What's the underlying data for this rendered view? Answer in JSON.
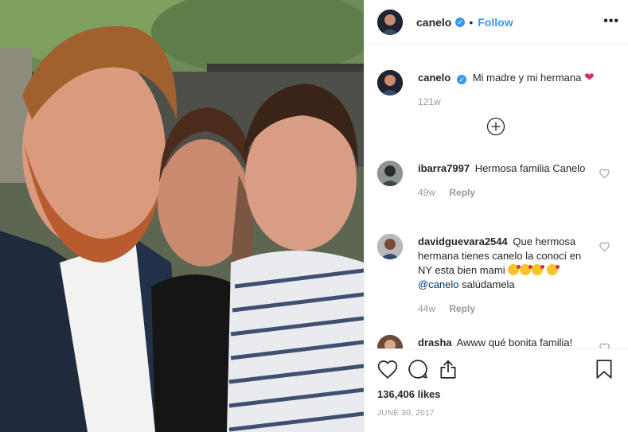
{
  "header": {
    "username": "canelo",
    "separator": "•",
    "follow_label": "Follow",
    "more_label": "•••"
  },
  "caption": {
    "username": "canelo",
    "text": "Mi madre y mi hermana",
    "time": "121w"
  },
  "load_more_icon": "plus-circle-icon",
  "comments": [
    {
      "username": "ibarra7997",
      "text": "Hermosa familia Canelo",
      "time": "49w",
      "reply_label": "Reply"
    },
    {
      "username": "davidguevara2544",
      "text_part1": "Que hermosa hermana tienes canelo la conocí en NY esta bien mami",
      "mention": "@canelo",
      "text_part2": "salúdamela",
      "time": "44w",
      "reply_label": "Reply"
    },
    {
      "username": "drasha",
      "text": "Awww qué bonita familia!"
    }
  ],
  "actions": {
    "icons": [
      "heart-icon",
      "comment-icon",
      "share-icon",
      "bookmark-icon"
    ],
    "likes": "136,406 likes",
    "date": "JUNE 30, 2017"
  },
  "colors": {
    "accent": "#3897f0",
    "text": "#262626",
    "muted": "#999999",
    "border": "#efefef",
    "heart": "#e0245e"
  }
}
